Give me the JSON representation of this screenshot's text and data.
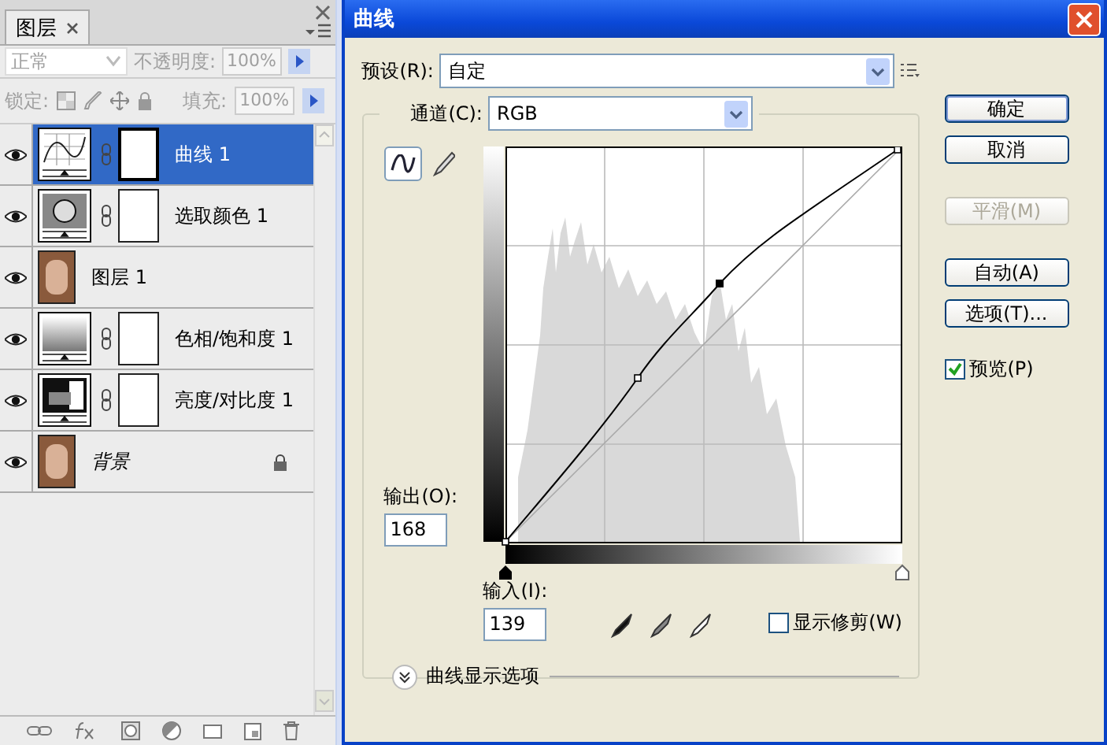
{
  "layers_panel": {
    "tab": {
      "label": "图层",
      "selected": true
    },
    "blend_mode": {
      "value": "正常",
      "disabled": true
    },
    "opacity": {
      "label": "不透明度:",
      "value": "100%",
      "disabled": true
    },
    "lock": {
      "label": "锁定:",
      "disabled": true
    },
    "fill": {
      "label": "填充:",
      "value": "100%",
      "disabled": true
    },
    "layers": [
      {
        "name": "曲线 1",
        "kind": "curves",
        "visible": true,
        "selected": true,
        "mask": true,
        "locked": false
      },
      {
        "name": "选取颜色 1",
        "kind": "selective-color",
        "visible": true,
        "selected": false,
        "mask": true,
        "locked": false
      },
      {
        "name": "图层 1",
        "kind": "photo",
        "visible": true,
        "selected": false,
        "mask": false,
        "locked": false
      },
      {
        "name": "色相/饱和度 1",
        "kind": "hue-saturation",
        "visible": true,
        "selected": false,
        "mask": true,
        "locked": false
      },
      {
        "name": "亮度/对比度 1",
        "kind": "brightness-contrast",
        "visible": true,
        "selected": false,
        "mask": true,
        "locked": false
      },
      {
        "name": "背景",
        "kind": "background",
        "visible": true,
        "selected": false,
        "mask": false,
        "locked": true
      }
    ]
  },
  "dialog": {
    "title": "曲线",
    "preset": {
      "label": "预设(R):",
      "value": "自定"
    },
    "channel": {
      "label": "通道(C):",
      "value": "RGB"
    },
    "tools": [
      {
        "kind": "curve",
        "selected": true
      },
      {
        "kind": "pencil",
        "selected": false
      }
    ],
    "output": {
      "label": "输出(O):",
      "value": "168"
    },
    "input": {
      "label": "输入(I):",
      "value": "139"
    },
    "shadows_slider": {
      "level": 0
    },
    "highlights_slider": {
      "level": 1
    },
    "show_clipping": {
      "label": "显示修剪(W)",
      "checked": false
    },
    "display_options": {
      "label": "曲线显示选项",
      "expanded": false
    },
    "buttons": [
      {
        "label": "确定",
        "disabled": false,
        "default": true
      },
      {
        "label": "取消",
        "disabled": false,
        "default": false
      },
      {
        "label": "平滑(M)",
        "disabled": true,
        "default": false
      },
      {
        "label": "自动(A)",
        "disabled": false,
        "default": false
      },
      {
        "label": "选项(T)...",
        "disabled": false,
        "default": false
      }
    ],
    "preview": {
      "label": "预览(P)",
      "checked": true
    }
  }
}
